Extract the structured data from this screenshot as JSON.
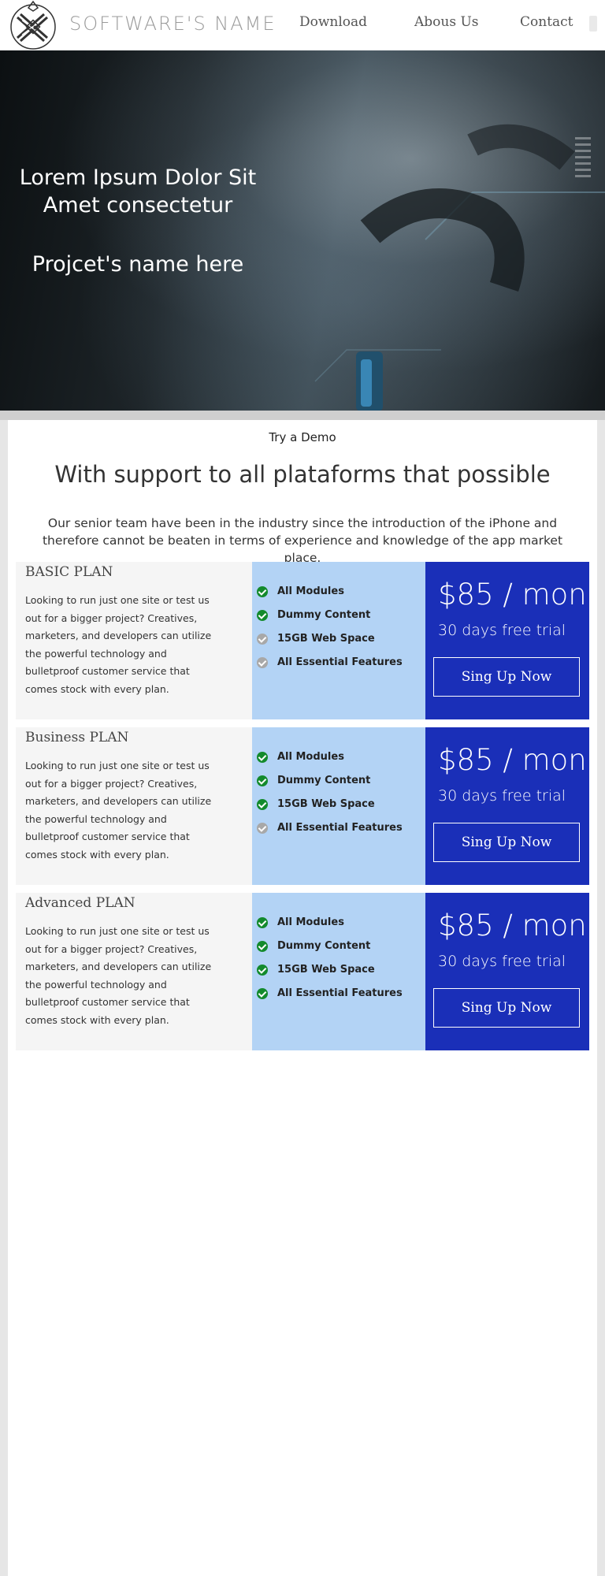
{
  "header": {
    "brand": "Software's Name",
    "nav": [
      "Download",
      "Abous Us",
      "Contact"
    ]
  },
  "hero": {
    "title_line1": "Lorem Ipsum Dolor Sit",
    "title_line2": "Amet consectetur",
    "subtitle": "Projcet's name here"
  },
  "content": {
    "try_demo": "Try a Demo",
    "headline": "With support to all plataforms that possible",
    "intro": "Our senior team have been in the industry since the introduction of the iPhone and therefore cannot be beaten in terms of experience and knowledge of the app market place."
  },
  "colors": {
    "accent_blue": "#1a2fb8",
    "light_blue": "#b3d3f5",
    "check_on": "#138a2c",
    "check_off": "#a8a8a8"
  },
  "plans": [
    {
      "name": "BASIC PLAN",
      "description": "Looking to run just one site or test us out for a bigger project? Creatives, marketers, and developers can utilize the powerful technology and bulletproof customer service that comes stock with every plan.",
      "features": [
        {
          "label": "All Modules",
          "included": true
        },
        {
          "label": "Dummy Content",
          "included": true
        },
        {
          "label": "15GB Web Space",
          "included": false
        },
        {
          "label": "All Essential Features",
          "included": false
        }
      ],
      "price": "$85 / mon",
      "trial": "30 days free trial",
      "cta": "Sing Up Now"
    },
    {
      "name": "Business PLAN",
      "description": "Looking to run just one site or test us out for a bigger project? Creatives, marketers, and developers can utilize the powerful technology and bulletproof customer service that comes stock with every plan.",
      "features": [
        {
          "label": "All Modules",
          "included": true
        },
        {
          "label": "Dummy Content",
          "included": true
        },
        {
          "label": "15GB Web Space",
          "included": true
        },
        {
          "label": "All Essential Features",
          "included": false
        }
      ],
      "price": "$85 / mon",
      "trial": "30 days free trial",
      "cta": "Sing Up Now"
    },
    {
      "name": "Advanced PLAN",
      "description": "Looking to run just one site or test us out for a bigger project? Creatives, marketers, and developers can utilize the powerful technology and bulletproof customer service that comes stock with every plan.",
      "features": [
        {
          "label": "All Modules",
          "included": true
        },
        {
          "label": "Dummy Content",
          "included": true
        },
        {
          "label": "15GB Web Space",
          "included": true
        },
        {
          "label": "All Essential Features",
          "included": true
        }
      ],
      "price": "$85 / mon",
      "trial": "30 days free trial",
      "cta": "Sing Up Now"
    }
  ]
}
